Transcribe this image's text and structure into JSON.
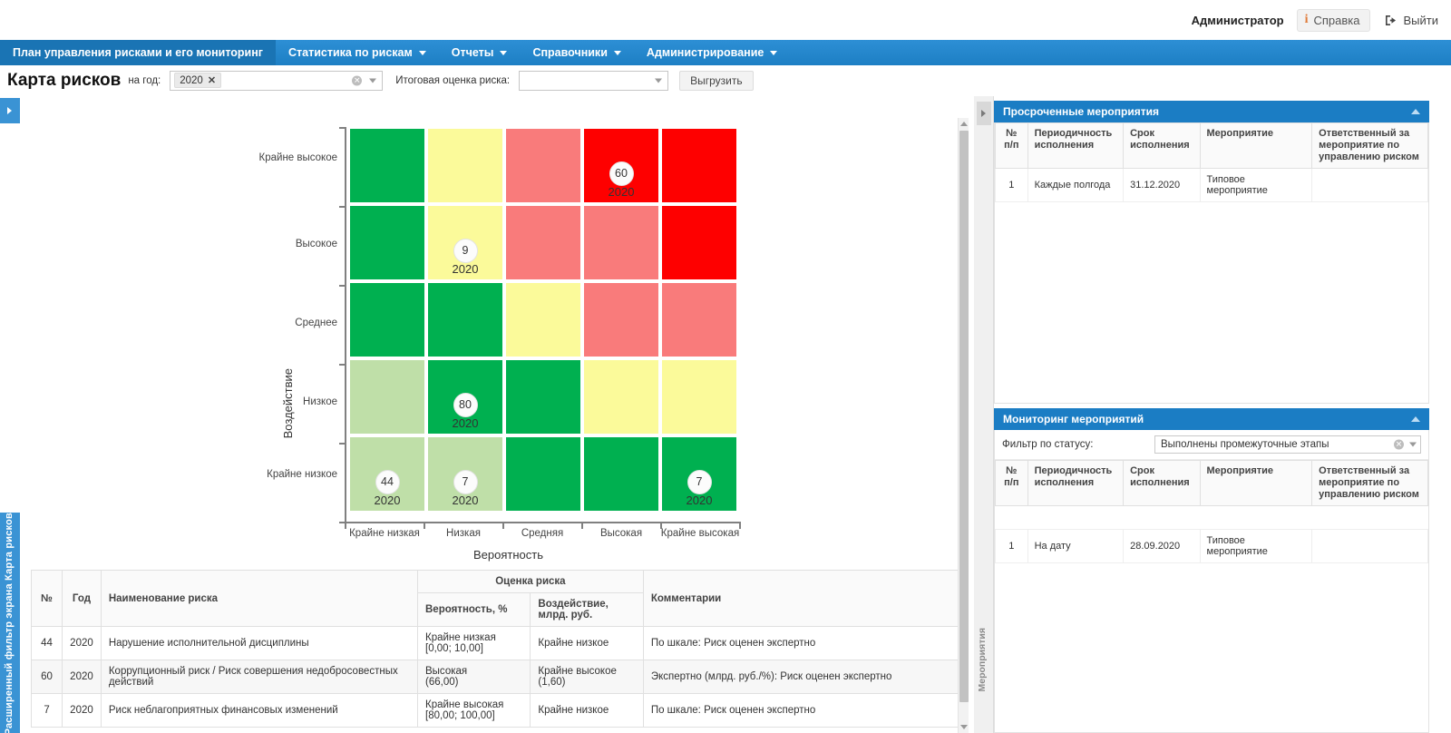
{
  "topbar": {
    "user": "Администратор",
    "help": "Справка",
    "logout": "Выйти"
  },
  "menu": [
    {
      "label": "План управления рисками и его мониторинг",
      "caret": false,
      "active": true
    },
    {
      "label": "Статистика по рискам",
      "caret": true,
      "active": false
    },
    {
      "label": "Отчеты",
      "caret": true,
      "active": false
    },
    {
      "label": "Справочники",
      "caret": true,
      "active": false
    },
    {
      "label": "Администрирование",
      "caret": true,
      "active": false
    }
  ],
  "filterbar": {
    "title": "Карта рисков",
    "year_label": "на год:",
    "year_tag": "2020",
    "eval_label": "Итоговая оценка риска:",
    "eval_value": "",
    "upload_button": "Выгрузить"
  },
  "left_rail": {
    "vertical_label": "Расширенный фильтр экрана Карта рисков"
  },
  "right_rail": {
    "vertical_label": "Мероприятия"
  },
  "chart_data": {
    "type": "heatmap",
    "title": "Карта рисков",
    "xlabel": "Вероятность",
    "ylabel": "Воздействие",
    "x_categories": [
      "Крайне низкая",
      "Низкая",
      "Средняя",
      "Высокая",
      "Крайне высокая"
    ],
    "y_categories": [
      "Крайне высокое",
      "Высокое",
      "Среднее",
      "Низкое",
      "Крайне низкое"
    ],
    "colors": {
      "green": "#00b050",
      "light_green": "#bfdfa8",
      "yellow": "#fbfa9a",
      "salmon": "#f97b7b",
      "red": "#fe0000"
    },
    "cells": [
      [
        "green",
        "yellow",
        "salmon",
        "red",
        "red"
      ],
      [
        "green",
        "yellow",
        "salmon",
        "salmon",
        "red"
      ],
      [
        "green",
        "green",
        "yellow",
        "salmon",
        "salmon"
      ],
      [
        "light_green",
        "green",
        "green",
        "yellow",
        "yellow"
      ],
      [
        "light_green",
        "light_green",
        "green",
        "green",
        "green"
      ]
    ],
    "points": [
      {
        "value": "60",
        "year": "2020",
        "col": 3,
        "row": 0
      },
      {
        "value": "9",
        "year": "2020",
        "col": 1,
        "row": 1
      },
      {
        "value": "80",
        "year": "2020",
        "col": 1,
        "row": 3
      },
      {
        "value": "44",
        "year": "2020",
        "col": 0,
        "row": 4
      },
      {
        "value": "7",
        "year": "2020",
        "col": 1,
        "row": 4
      },
      {
        "value": "7",
        "year": "2020",
        "col": 4,
        "row": 4
      }
    ]
  },
  "risk_table": {
    "group_header": "Оценка риска",
    "headers": {
      "num": "№",
      "year": "Год",
      "name": "Наименование риска",
      "probability": "Вероятность, %",
      "impact": "Воздействие, млрд. руб.",
      "comments": "Комментарии"
    },
    "rows": [
      {
        "num": "44",
        "year": "2020",
        "name": "Нарушение исполнительной дисциплины",
        "probability": "Крайне низкая\n[0,00; 10,00]",
        "impact": "Крайне низкое",
        "comments": "По шкале: Риск оценен экспертно"
      },
      {
        "num": "60",
        "year": "2020",
        "name": "Коррупционный риск / Риск совершения недобросовестных действий",
        "probability": "Высокая\n(66,00)",
        "impact": "Крайне высокое\n(1,60)",
        "comments": "Экспертно (млрд. руб./%): Риск оценен экспертно"
      },
      {
        "num": "7",
        "year": "2020",
        "name": "Риск неблагоприятных финансовых изменений",
        "probability": "Крайне высокая\n[80,00; 100,00]",
        "impact": "Крайне низкое",
        "comments": "По шкале: Риск оценен экспертно"
      }
    ]
  },
  "overdue_panel": {
    "title": "Просроченные мероприятия",
    "headers": {
      "num": "№\nп/п",
      "periodicity": "Периодичность\nисполнения",
      "deadline": "Срок\nисполнения",
      "activity": "Мероприятие",
      "responsible": "Ответственный за\nмероприятие по\nуправлению риском"
    },
    "rows": [
      {
        "num": "1",
        "periodicity": "Каждые полгода",
        "deadline": "31.12.2020",
        "activity": "Типовое мероприятие",
        "responsible": ""
      }
    ]
  },
  "monitoring_panel": {
    "title": "Мониторинг мероприятий",
    "filter_label": "Фильтр по статусу:",
    "filter_value": "Выполнены промежуточные этапы",
    "headers": {
      "num": "№\nп/п",
      "periodicity": "Периодичность\nисполнения",
      "deadline": "Срок\nисполнения",
      "activity": "Мероприятие",
      "responsible": "Ответственный за\nмероприятие по\nуправлению риском"
    },
    "rows": [
      {
        "num": "1",
        "periodicity": "На дату",
        "deadline": "28.09.2020",
        "activity": "Типовое мероприятие",
        "responsible": ""
      }
    ]
  }
}
